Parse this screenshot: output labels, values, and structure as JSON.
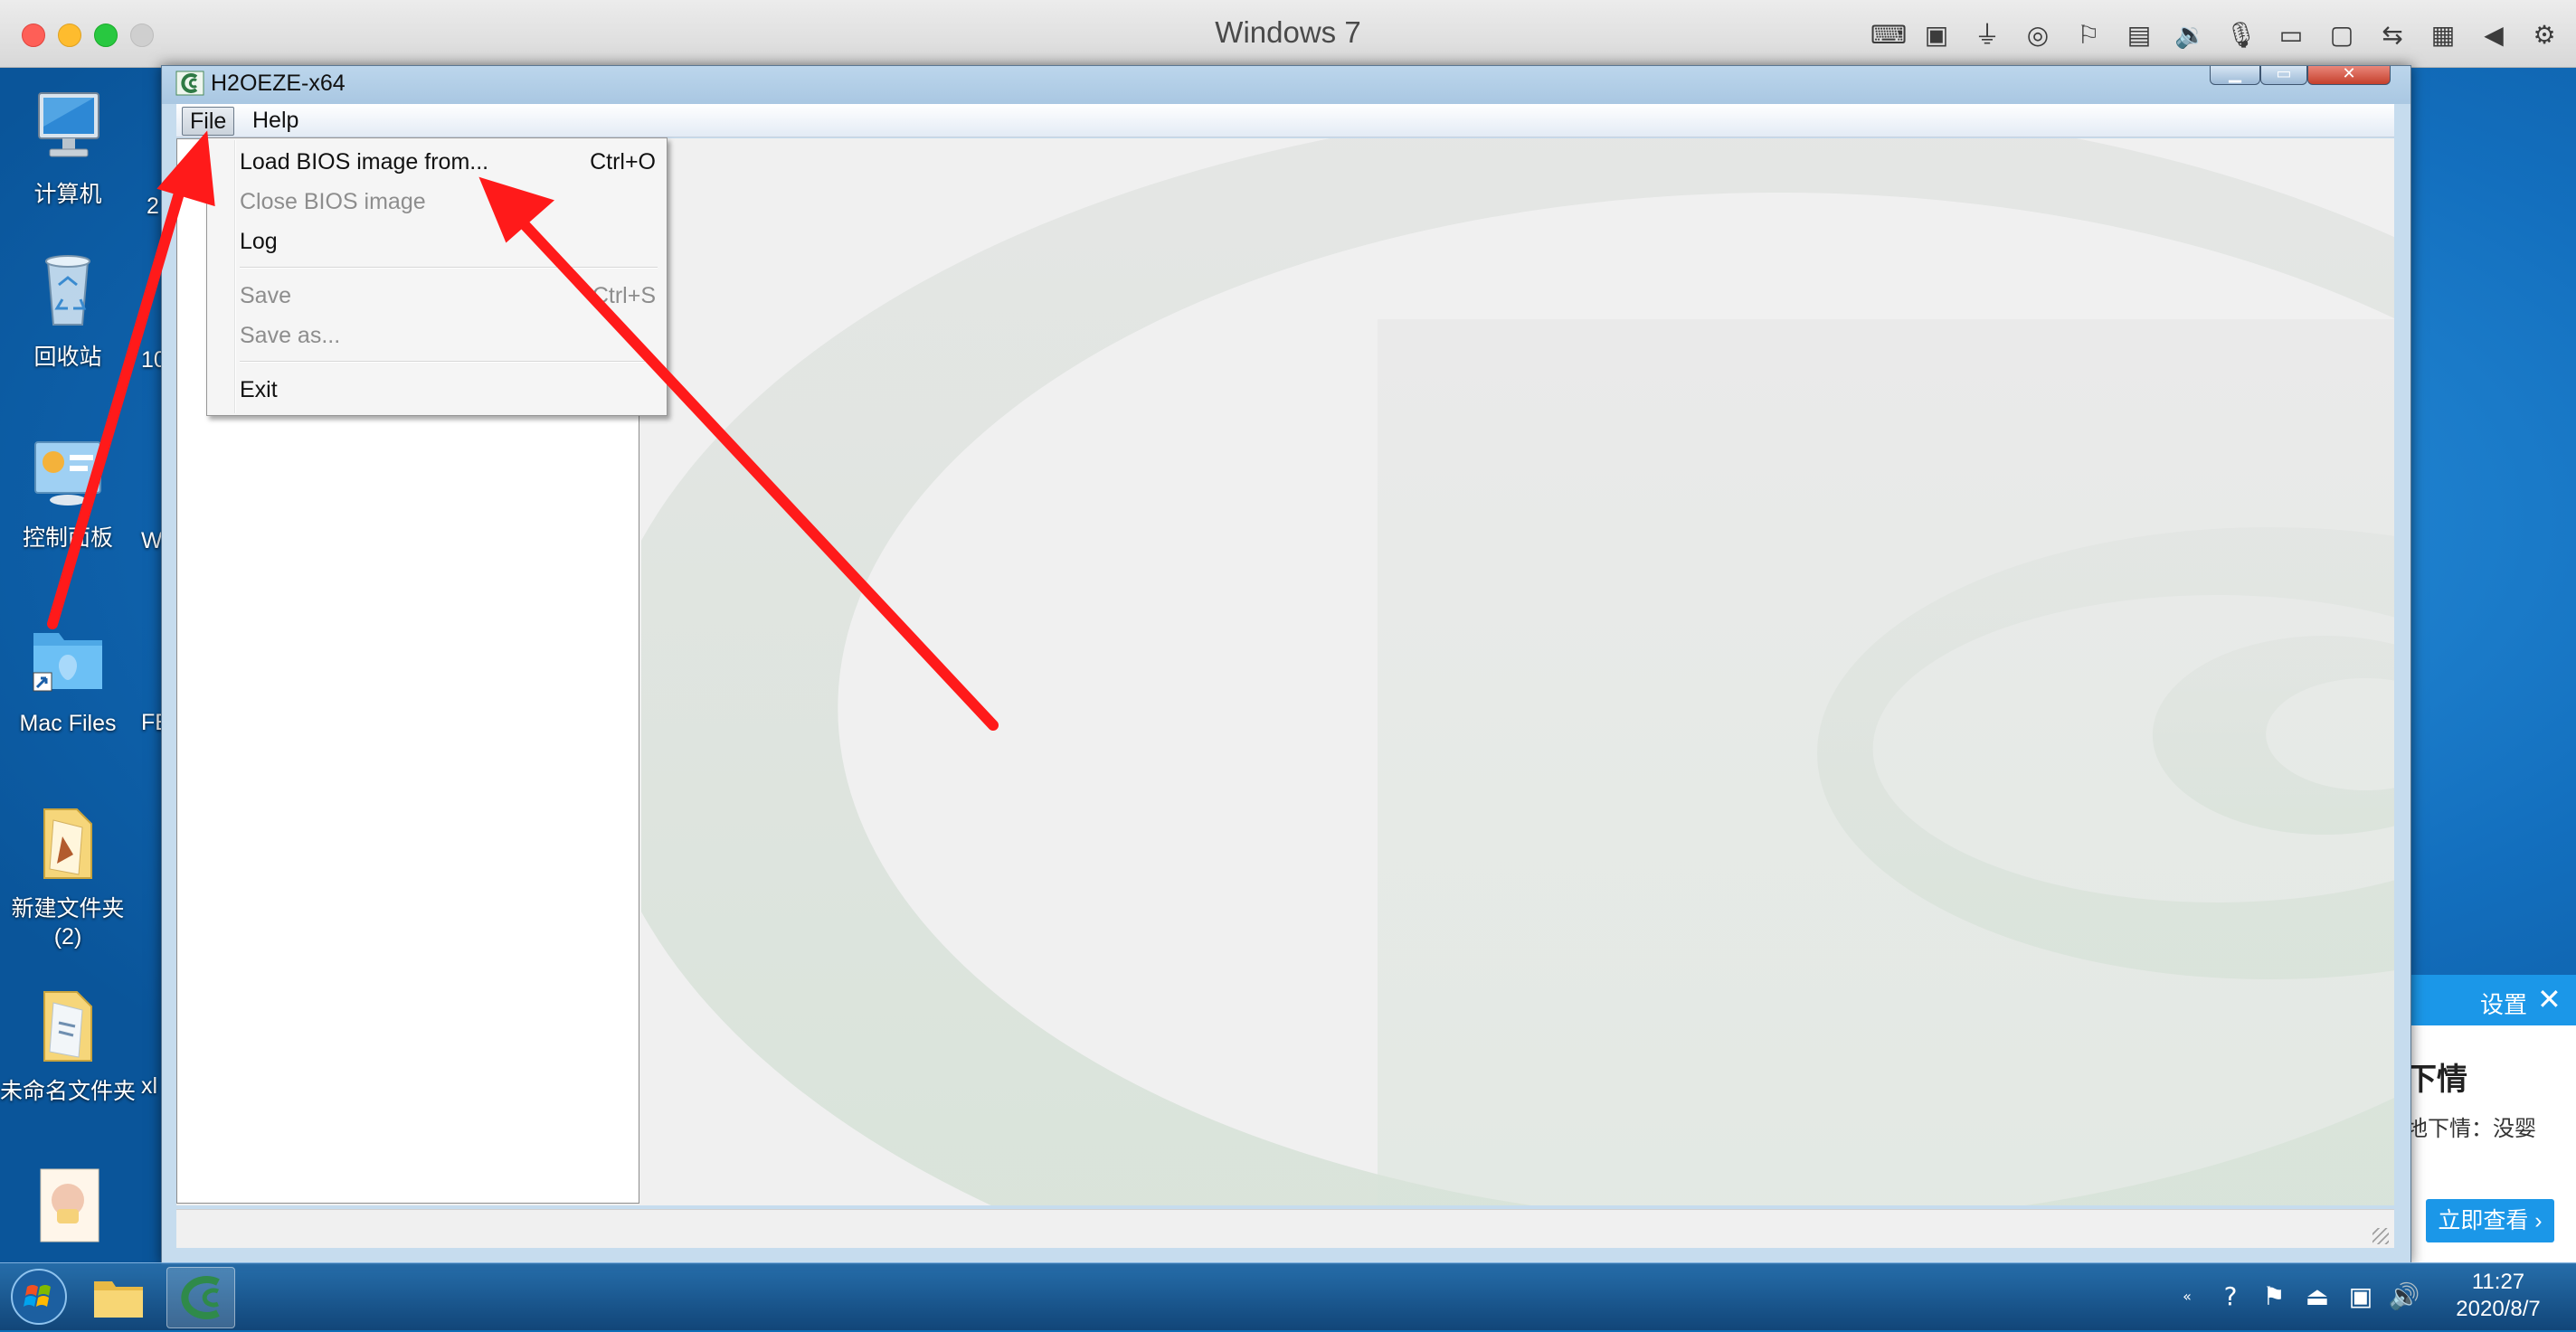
{
  "vm": {
    "title": "Windows 7",
    "tools": [
      "keyboard-icon",
      "cpu-icon",
      "usb-icon",
      "cd-icon",
      "network-icon",
      "floppy-icon",
      "sound-icon",
      "microphone-icon",
      "hard-disk-icon",
      "camera-icon",
      "shared-folder-icon",
      "terminal-icon",
      "triangle-left-icon",
      "gear-icon"
    ]
  },
  "desktop": {
    "icons": [
      {
        "label": "计算机"
      },
      {
        "label": "回收站"
      },
      {
        "label": "控制面板"
      },
      {
        "label": "Mac Files"
      },
      {
        "label": "新建文件夹\n(2)"
      },
      {
        "label": "未命名文件夹"
      },
      {
        "label": ""
      }
    ],
    "clipped_labels": [
      "2",
      "10",
      "W",
      "FE",
      "xl"
    ]
  },
  "notification": {
    "settings": "设置",
    "title": "下情",
    "body": "地下情：没婴",
    "button": "立即查看 ›"
  },
  "app": {
    "title": "H2OEZE-x64",
    "menu": {
      "file": "File",
      "help": "Help"
    },
    "file_menu": {
      "load": {
        "label": "Load BIOS image from...",
        "shortcut": "Ctrl+O"
      },
      "close": {
        "label": "Close BIOS image"
      },
      "log": {
        "label": "Log"
      },
      "save": {
        "label": "Save",
        "shortcut": "Ctrl+S"
      },
      "save_as": {
        "label": "Save as..."
      },
      "exit": {
        "label": "Exit"
      }
    }
  },
  "taskbar": {
    "time": "11:27",
    "date": "2020/8/7"
  },
  "colors": {
    "annotation_arrow": "#ff1a1a",
    "accent": "#1b97e8"
  }
}
